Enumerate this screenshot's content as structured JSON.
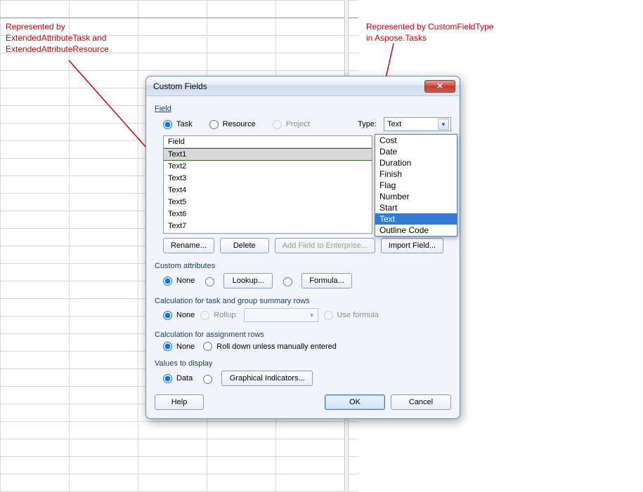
{
  "annotations": {
    "left": "Represented by\nExtendedAttributeTask and\nExtendedAttributeResource",
    "right": "Represented by CustomFieldType\nin Aspose.Tasks"
  },
  "dialog": {
    "title": "Custom Fields",
    "close_glyph": "✕",
    "field_label": "Field",
    "radios": {
      "task": "Task",
      "resource": "Resource",
      "project": "Project"
    },
    "type_label": "Type:",
    "type_value": "Text",
    "type_options": [
      "Cost",
      "Date",
      "Duration",
      "Finish",
      "Flag",
      "Number",
      "Start",
      "Text",
      "Outline Code"
    ],
    "type_highlight": "Text",
    "field_header": "Field",
    "fields": [
      "Text1",
      "Text2",
      "Text3",
      "Text4",
      "Text5",
      "Text6",
      "Text7"
    ],
    "field_selected": "Text1",
    "buttons": {
      "rename": "Rename...",
      "delete": "Delete",
      "addent": "Add Field to Enterprise...",
      "import": "Import Field..."
    },
    "custom_attr_label": "Custom attributes",
    "none": "None",
    "lookup": "Lookup...",
    "formula": "Formula...",
    "calc_rows_label": "Calculation for task and group summary rows",
    "rollup_label": "Rollup:",
    "use_formula": "Use formula",
    "calc_assign_label": "Calculation for assignment rows",
    "rolldown": "Roll down unless manually entered",
    "values_label": "Values to display",
    "data_label": "Data",
    "graphical": "Graphical Indicators...",
    "help": "Help",
    "ok": "OK",
    "cancel": "Cancel"
  }
}
